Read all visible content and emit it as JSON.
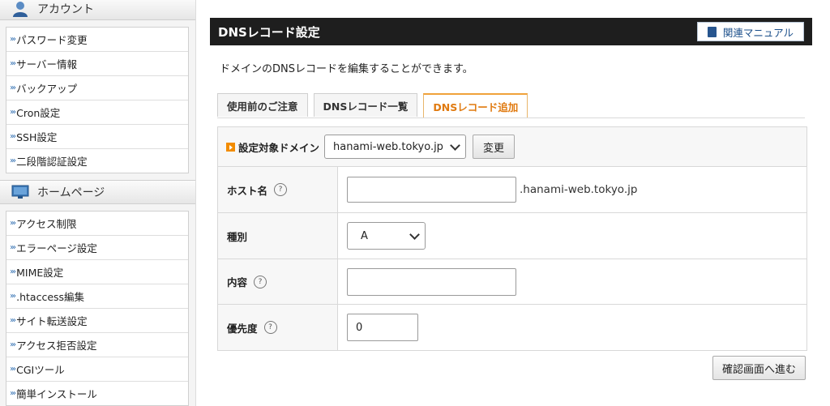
{
  "sidebar": {
    "account": {
      "title": "アカウント",
      "items": [
        "パスワード変更",
        "サーバー情報",
        "バックアップ",
        "Cron設定",
        "SSH設定",
        "二段階認証設定"
      ]
    },
    "homepage": {
      "title": "ホームページ",
      "items": [
        "アクセス制限",
        "エラーページ設定",
        "MIME設定",
        ".htaccess編集",
        "サイト転送設定",
        "アクセス拒否設定",
        "CGIツール",
        "簡単インストール"
      ]
    }
  },
  "panel": {
    "title": "DNSレコード設定",
    "manual_label": "関連マニュアル",
    "description": "ドメインのDNSレコードを編集することができます。"
  },
  "tabs": [
    {
      "label": "使用前のご注意",
      "active": false
    },
    {
      "label": "DNSレコード一覧",
      "active": false
    },
    {
      "label": "DNSレコード追加",
      "active": true
    }
  ],
  "form": {
    "domain_label": "設定対象ドメイン",
    "domain_value": "hanami-web.tokyo.jp",
    "change_button": "変更",
    "host_label": "ホスト名",
    "host_value": "",
    "host_suffix": ".hanami-web.tokyo.jp",
    "type_label": "種別",
    "type_value": "A",
    "content_label": "内容",
    "content_value": "",
    "priority_label": "優先度",
    "priority_value": "0",
    "help_mark": "?",
    "confirm_button": "確認画面へ進む"
  },
  "colors": {
    "header_bg": "#1e1e1e",
    "active_tab": "#e07a10",
    "link_arrow": "#2f6db0"
  }
}
